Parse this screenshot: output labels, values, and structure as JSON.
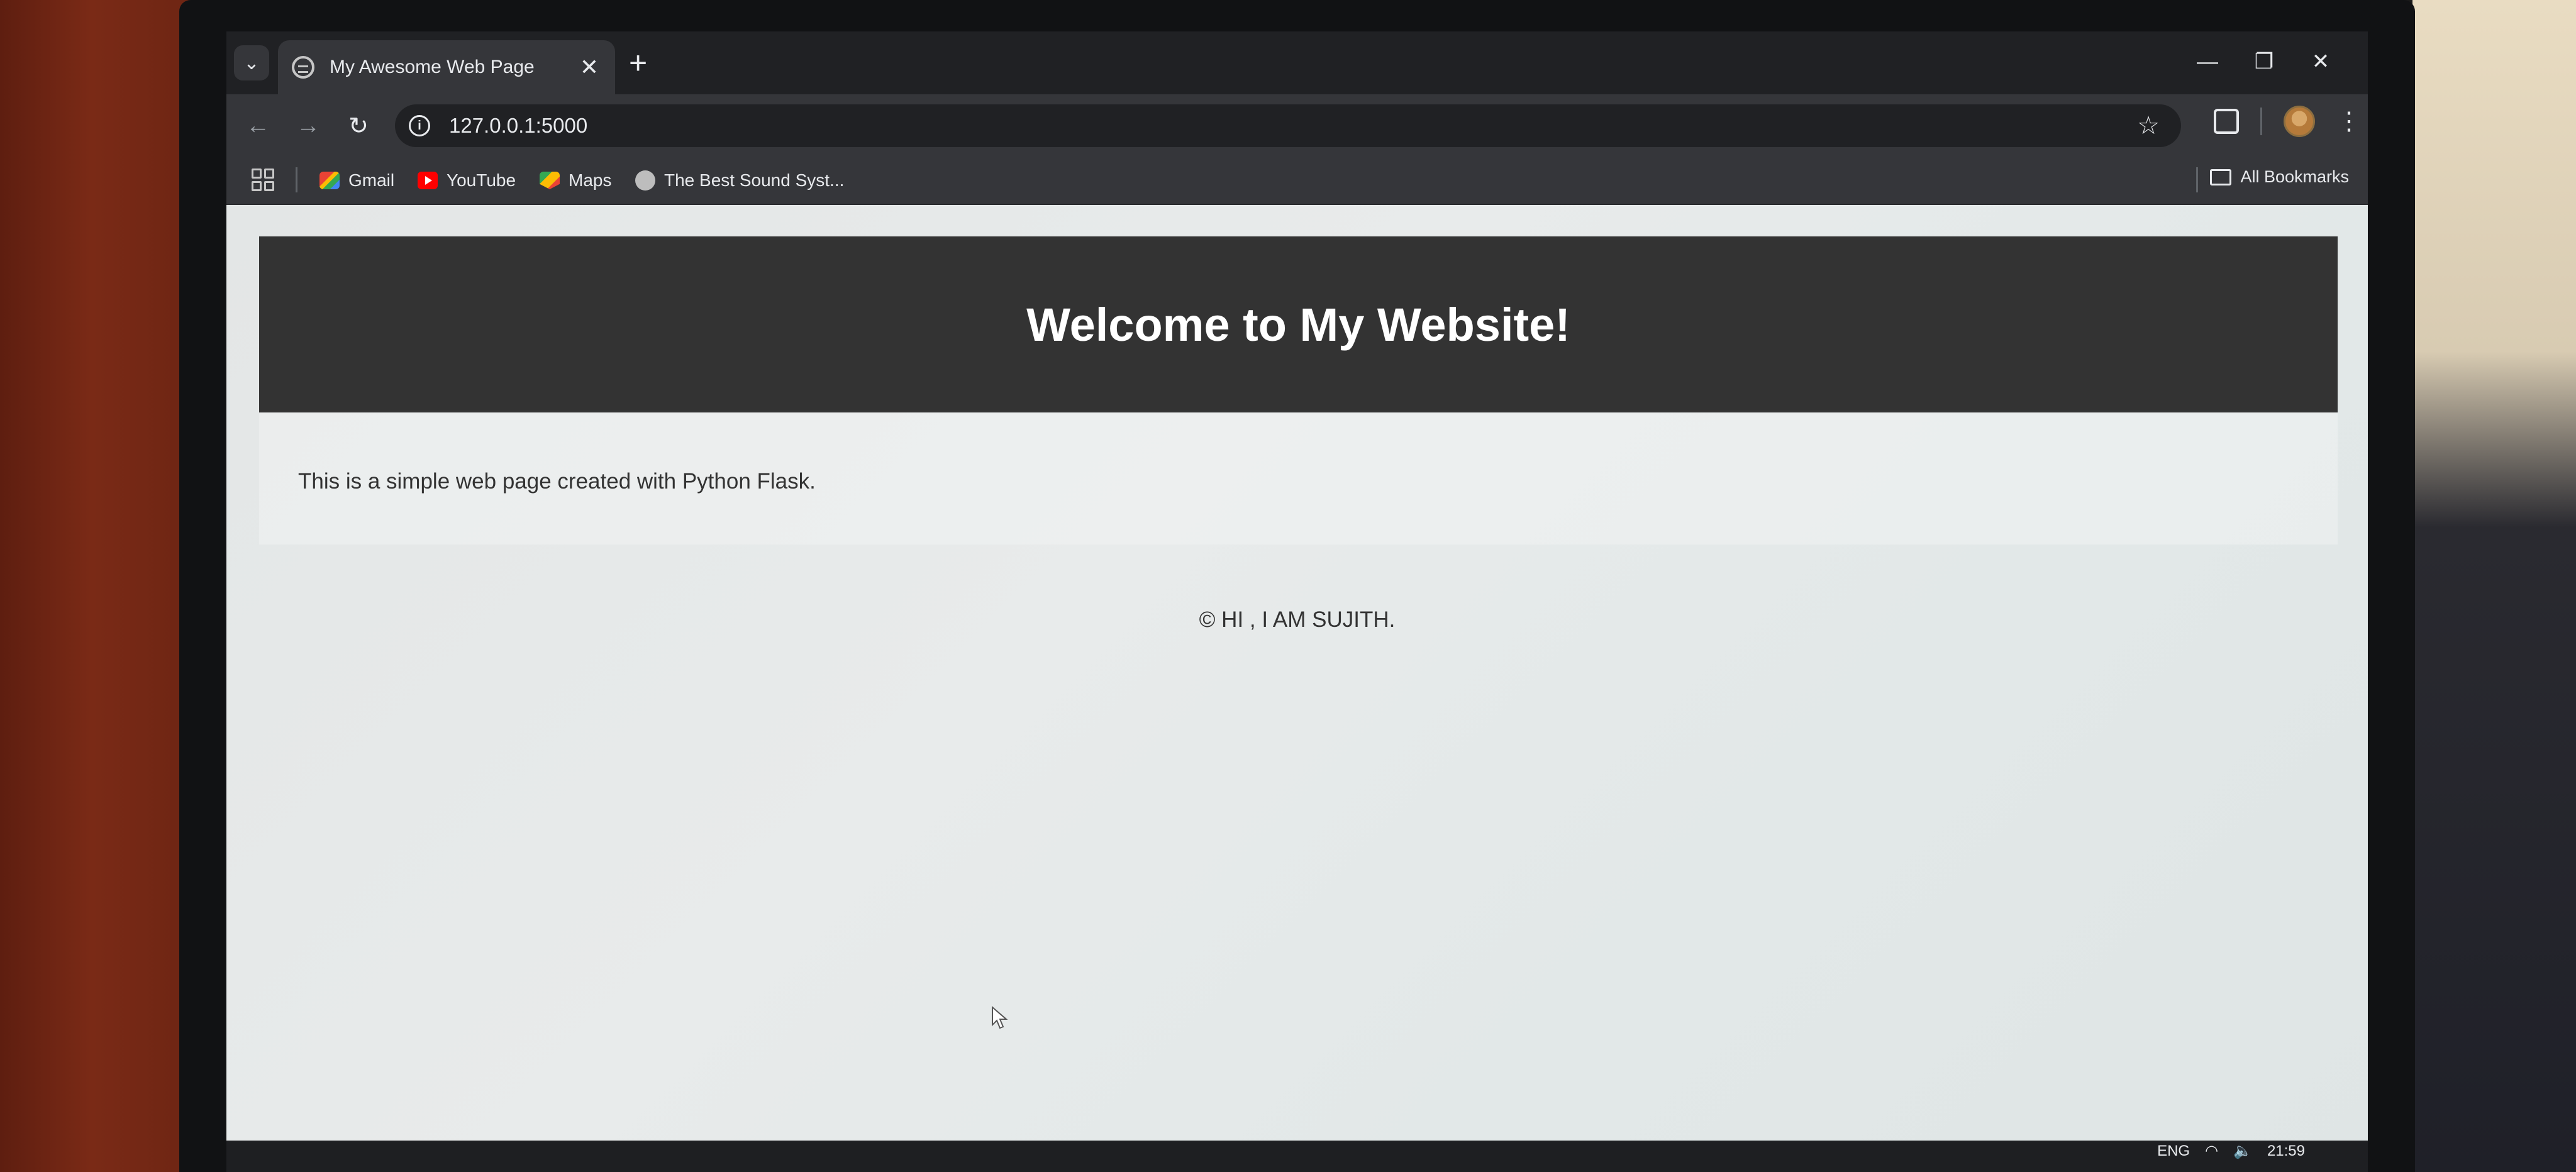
{
  "browser": {
    "tab": {
      "title": "My Awesome Web Page",
      "close_glyph": "✕"
    },
    "new_tab_glyph": "+",
    "window_controls": {
      "minimize": "—",
      "restore": "❐",
      "close": "✕"
    },
    "address_bar": {
      "url": "127.0.0.1:5000"
    },
    "bookmarks": [
      {
        "label": "Gmail",
        "icon": "gmail-icon"
      },
      {
        "label": "YouTube",
        "icon": "youtube-icon"
      },
      {
        "label": "Maps",
        "icon": "maps-icon"
      },
      {
        "label": "The Best Sound Syst...",
        "icon": "globe-icon"
      }
    ],
    "all_bookmarks_label": "All Bookmarks"
  },
  "page": {
    "header_title": "Welcome to My Website!",
    "intro_text": "This is a simple web page created with Python Flask.",
    "footer_text": "© HI , I AM SUJITH."
  },
  "taskbar": {
    "language": "ENG",
    "time": "21:59"
  },
  "colors": {
    "header_bg": "#333333",
    "page_bg": "#e6e9e9",
    "browser_chrome": "#35363a"
  }
}
